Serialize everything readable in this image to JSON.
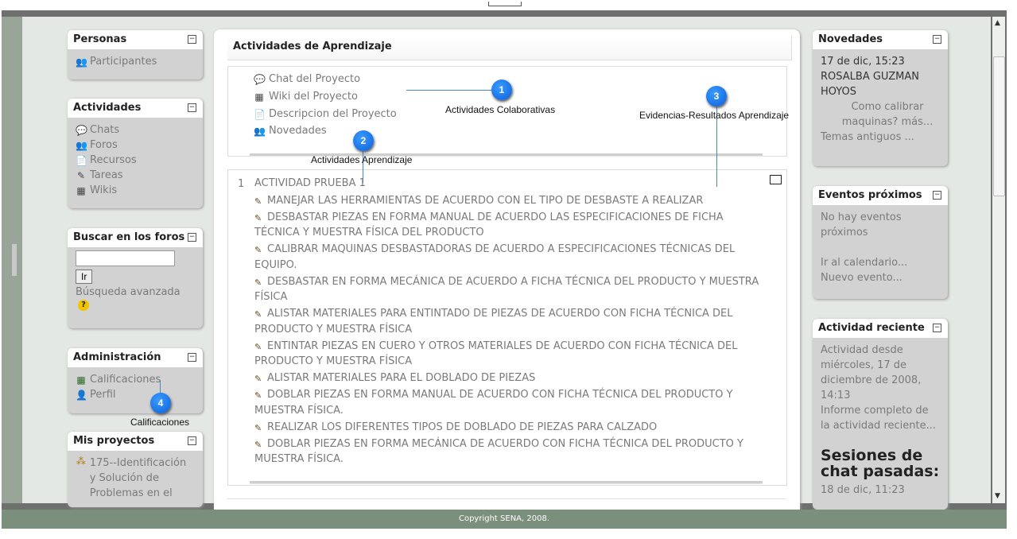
{
  "left": {
    "personas": {
      "title": "Personas",
      "toggle": "−",
      "participantes": "Participantes"
    },
    "actividades": {
      "title": "Actividades",
      "toggle": "−",
      "items": [
        "Chats",
        "Foros",
        "Recursos",
        "Tareas",
        "Wikis"
      ]
    },
    "buscar": {
      "title": "Buscar en los foros",
      "toggle": "−",
      "button": "Ir",
      "advanced": "Búsqueda avanzada",
      "help": "?"
    },
    "admin": {
      "title": "Administración",
      "toggle": "−",
      "items": [
        "Calificaciones",
        "Perfil"
      ]
    },
    "proyectos": {
      "title": "Mis proyectos",
      "toggle": "−",
      "item": "175--Identificación y Solución de Problemas en el"
    }
  },
  "main": {
    "title": "Actividades de Aprendizaje",
    "section0": [
      "Chat del Proyecto",
      "Wiki del Proyecto",
      "Descripcion del Proyecto",
      "Novedades"
    ],
    "section1": {
      "number": "1",
      "heading": "ACTIVIDAD PRUEBA 1",
      "activities": [
        "MANEJAR LAS HERRAMIENTAS DE ACUERDO CON EL TIPO DE DESBASTE A REALIZAR",
        "DESBASTAR PIEZAS EN FORMA MANUAL DE ACUERDO LAS ESPECIFICACIONES DE FICHA TÉCNICA Y MUESTRA FÍSICA DEL PRODUCTO",
        "CALIBRAR MAQUINAS DESBASTADORAS DE ACUERDO A ESPECIFICACIONES TÉCNICAS DEL EQUIPO.",
        "DESBASTAR EN FORMA MECÁNICA DE ACUERDO A FICHA TÉCNICA DEL PRODUCTO Y MUESTRA FÍSICA",
        "ALISTAR MATERIALES PARA ENTINTADO DE PIEZAS DE ACUERDO CON FICHA TÉCNICA DEL PRODUCTO Y MUESTRA FÍSICA",
        "ENTINTAR PIEZAS EN CUERO Y OTROS MATERIALES DE ACUERDO CON FICHA TÉCNICA DEL PRODUCTO Y MUESTRA FÍSICA",
        "ALISTAR MATERIALES PARA EL DOBLADO DE PIEZAS",
        "DOBLAR PIEZAS EN FORMA MANUAL DE ACUERDO CON FICHA TÉCNICA DEL PRODUCTO Y MUESTRA FÍSICA.",
        "REALIZAR LOS DIFERENTES TIPOS DE DOBLADO DE PIEZAS PARA CALZADO",
        "DOBLAR PIEZAS EN FORMA MECÁNICA DE ACUERDO CON FICHA TÉCNICA DEL PRODUCTO Y MUESTRA FÍSICA."
      ]
    }
  },
  "right": {
    "novedades": {
      "title": "Novedades",
      "toggle": "−",
      "date": "17 de dic, 15:23",
      "author": "ROSALBA GUZMAN HOYOS",
      "post": "Como calibrar maquinas? más...",
      "older": "Temas antiguos ..."
    },
    "eventos": {
      "title": "Eventos próximos",
      "toggle": "−",
      "none": "No hay eventos próximos",
      "calendar": "Ir al calendario...",
      "new": "Nuevo evento..."
    },
    "reciente": {
      "title": "Actividad reciente",
      "toggle": "−",
      "since": "Actividad desde miércoles, 17 de diciembre de 2008, 14:13",
      "report": "Informe completo de la actividad reciente...",
      "chat_title": "Sesiones de chat pasadas:",
      "chat_date": "18 de dic, 11:23"
    }
  },
  "callouts": [
    {
      "n": "1",
      "label": "Actividades Colaborativas"
    },
    {
      "n": "2",
      "label": "Actividades Aprendizaje"
    },
    {
      "n": "3",
      "label": "Evidencias-Resultados Aprendizaje"
    },
    {
      "n": "4",
      "label": "Calificaciones"
    }
  ],
  "footer": "Copyright SENA, 2008."
}
